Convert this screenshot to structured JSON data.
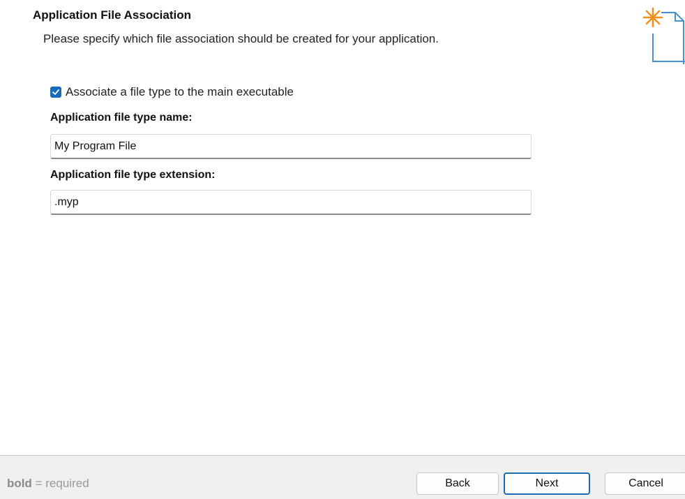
{
  "header": {
    "title": "Application File Association",
    "subtitle": "Please specify which file association should be created for your application."
  },
  "form": {
    "associate_checkbox": {
      "label": "Associate a file type to the main executable",
      "checked": true
    },
    "type_name": {
      "label": "Application file type name:",
      "value": "My Program File"
    },
    "type_extension": {
      "label": "Application file type extension:",
      "value": ".myp"
    }
  },
  "footer": {
    "legend_bold": "bold",
    "legend_rest": "= required",
    "back_label": "Back",
    "next_label": "Next",
    "cancel_label": "Cancel"
  },
  "colors": {
    "accent": "#1a6bb8",
    "logo_star": "#f0901e",
    "logo_doc": "#4a90d0"
  },
  "icons": {
    "logo": "new-file-star-icon",
    "check": "checkmark-icon"
  }
}
